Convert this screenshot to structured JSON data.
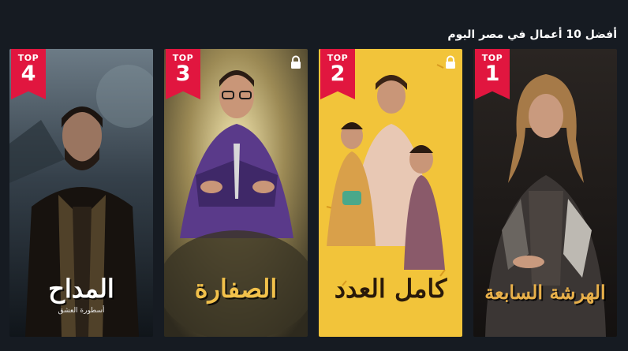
{
  "section": {
    "title": "أفضل 10 أعمال في مصر اليوم"
  },
  "cards": [
    {
      "rank": "1",
      "badge": "TOP",
      "title": "الهرشة السابعة",
      "locked": false,
      "title_color": "#e8b04a"
    },
    {
      "rank": "2",
      "badge": "TOP",
      "title": "كامل العدد",
      "locked": true,
      "title_color": "#2a1a0a"
    },
    {
      "rank": "3",
      "badge": "TOP",
      "title": "الصفارة",
      "locked": true,
      "title_color": "#f2c14b"
    },
    {
      "rank": "4",
      "badge": "TOP",
      "title": "المداح",
      "subtitle": "أسطورة العشق",
      "locked": false,
      "title_color": "#ffffff"
    }
  ],
  "colors": {
    "background": "#161b22",
    "badge": "#e1163f"
  }
}
